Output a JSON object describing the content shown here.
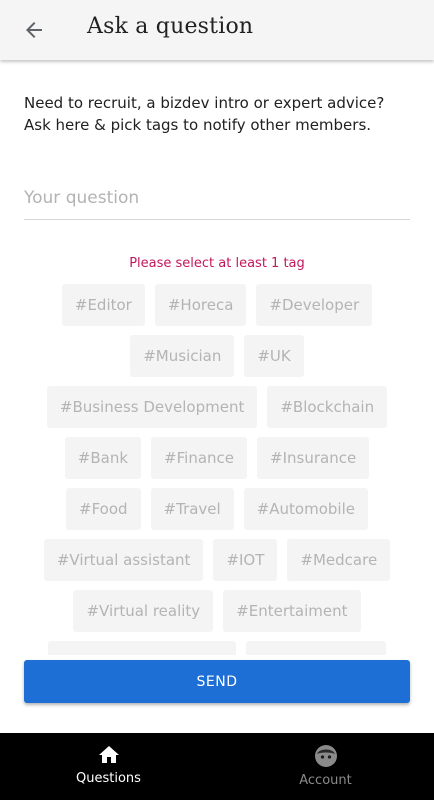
{
  "header": {
    "title": "Ask a question",
    "back_icon": "arrow-back-icon"
  },
  "intro": {
    "text": "Need to recruit, a bizdev intro or expert advice? Ask here & pick tags to notify other members."
  },
  "question": {
    "placeholder": "Your question",
    "value": ""
  },
  "validation": {
    "message": "Please select at least 1 tag"
  },
  "tags": {
    "rows": [
      [
        "#Editor",
        "#Horeca",
        "#Developer"
      ],
      [
        "#Musician",
        "#UK"
      ],
      [
        "#Business Development",
        "#Blockchain"
      ],
      [
        "#Bank",
        "#Finance",
        "#Insurance"
      ],
      [
        "#Food",
        "#Travel",
        "#Automobile"
      ],
      [
        "#Virtual assistant",
        "#IOT",
        "#Medcare"
      ],
      [
        "#Virtual reality",
        "#Entertaiment"
      ]
    ]
  },
  "send": {
    "label": "SEND"
  },
  "bottom_nav": {
    "items": [
      {
        "label": "Questions",
        "icon": "home-icon",
        "active": true
      },
      {
        "label": "Account",
        "icon": "account-face-icon",
        "active": false
      }
    ]
  },
  "colors": {
    "accent": "#1d6fd6",
    "error": "#c2185b",
    "nav_bg": "#000000"
  }
}
